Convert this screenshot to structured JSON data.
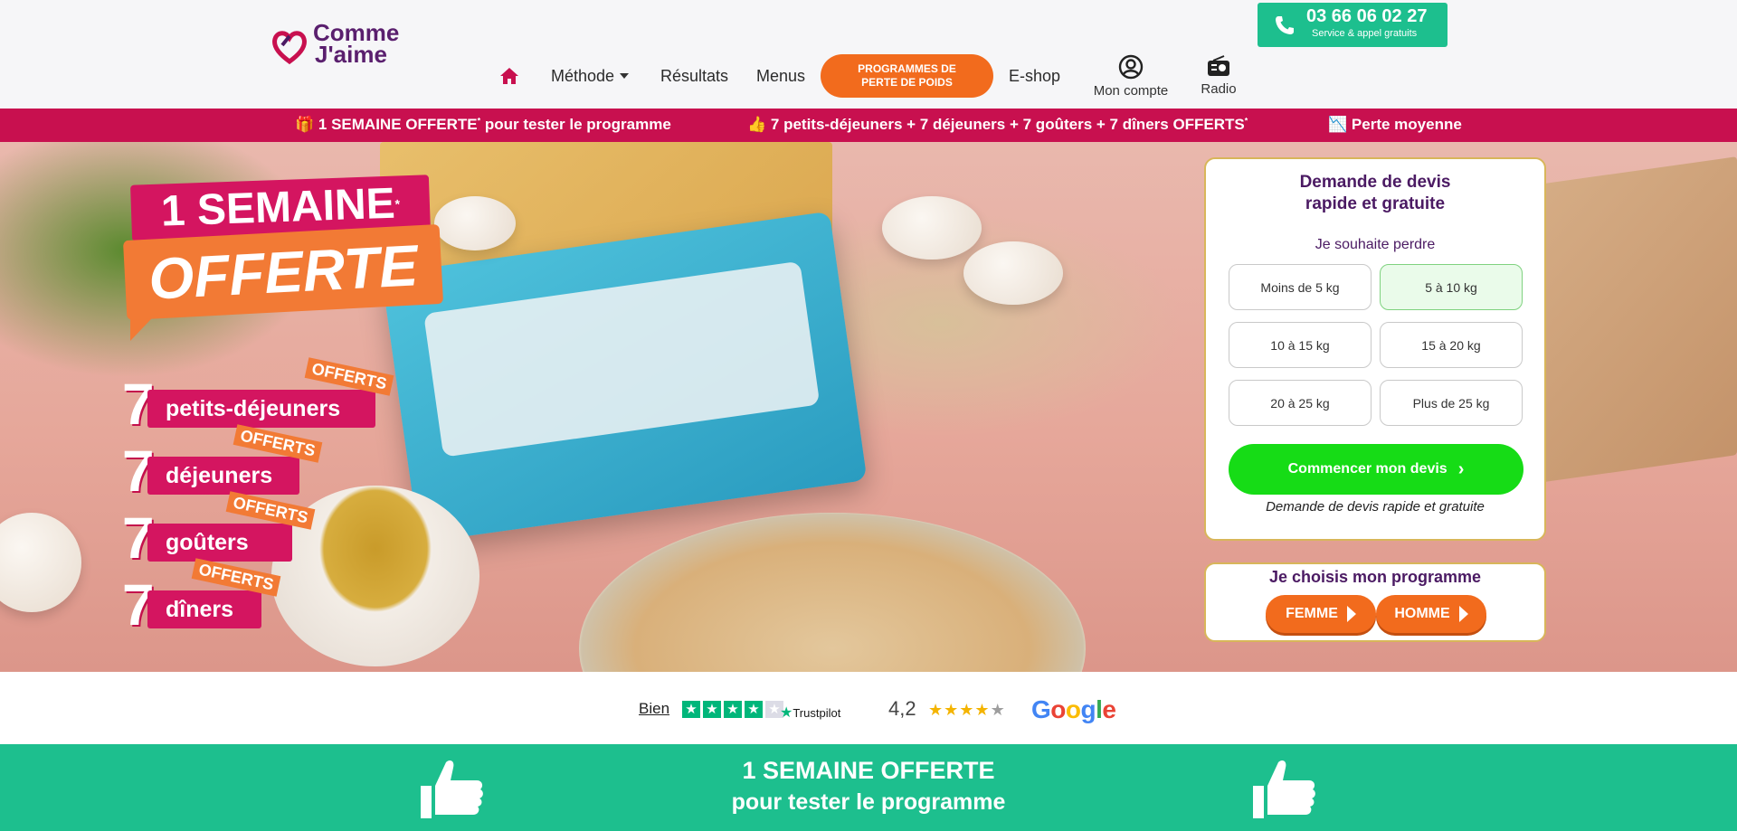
{
  "header": {
    "logo": {
      "line1": "Comme",
      "line2": "J'aime"
    },
    "nav": {
      "home_icon": "home-icon",
      "methode": "Méthode",
      "resultats": "Résultats",
      "menus": "Menus",
      "programmes_line1": "PROGRAMMES DE",
      "programmes_line2": "PERTE DE POIDS",
      "eshop": "E-shop",
      "mon_compte": "Mon compte",
      "radio": "Radio"
    },
    "phone": {
      "number": "03 66 06 02 27",
      "sub": "Service & appel gratuits"
    }
  },
  "ticker": {
    "item1_pre": "1 SEMAINE OFFERTE",
    "item1_post": " pour tester le programme",
    "item2_pre": "7 petits-déjeuners + 7 déjeuners + 7 goûters + 7 dîners OFFERTS",
    "item3": "Perte moyenne",
    "star": "*",
    "icons": [
      "gift-icon",
      "thumbs-up-icon",
      "chart-icon"
    ]
  },
  "hero": {
    "badge_top": "1 SEMAINE",
    "badge_star": "*",
    "badge_bottom": "OFFERTE",
    "meals": [
      {
        "n": "7",
        "label": "petits-déjeuners",
        "offert": "OFFERTS"
      },
      {
        "n": "7",
        "label": "déjeuners",
        "offert": "OFFERTS"
      },
      {
        "n": "7",
        "label": "goûters",
        "offert": "OFFERTS"
      },
      {
        "n": "7",
        "label": "dîners",
        "offert": "OFFERTS"
      }
    ]
  },
  "quote": {
    "title_line1": "Demande de devis",
    "title_line2": "rapide et gratuite",
    "subtitle": "Je souhaite perdre",
    "options": [
      "Moins de 5 kg",
      "5 à 10 kg",
      "10 à 15 kg",
      "15 à 20 kg",
      "20 à 25 kg",
      "Plus de 25 kg"
    ],
    "selected": "5 à 10 kg",
    "cta": "Commencer mon devis",
    "footer": "Demande de devis rapide et gratuite"
  },
  "choose": {
    "title": "Je choisis mon programme",
    "femme": "FEMME",
    "homme": "HOMME"
  },
  "ratings": {
    "trustpilot_label": "Bien",
    "trustpilot_brand": "Trustpilot",
    "trustpilot_stars": 4,
    "google_score": "4,2",
    "google_stars": 4,
    "google_brand": "Google"
  },
  "banner": {
    "line1": "1 SEMAINE OFFERTE",
    "line2": "pour tester le programme"
  },
  "colors": {
    "brand_purple": "#4b1a63",
    "brand_pink": "#c8104f",
    "orange": "#f26b1d",
    "green": "#1dbf8e",
    "cta_green": "#16dc16"
  }
}
